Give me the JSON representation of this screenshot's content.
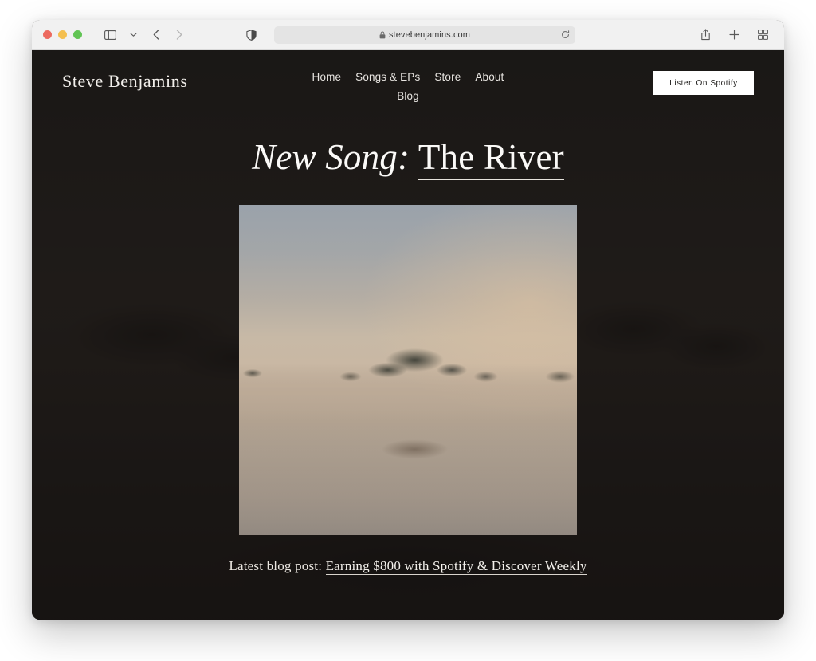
{
  "browser": {
    "traffic_lights": [
      "close",
      "minimize",
      "zoom"
    ],
    "sidebar_icon": "sidebar-icon",
    "chevron_icon": "chevron-down-icon",
    "back_icon": "back-arrow-icon",
    "forward_icon": "forward-arrow-icon",
    "shield_icon": "shield-privacy-icon",
    "lock_icon": "lock-icon",
    "reload_icon": "reload-icon",
    "share_icon": "share-icon",
    "new_tab_icon": "plus-icon",
    "tab_overview_icon": "tab-overview-icon",
    "url": "stevebenjamins.com"
  },
  "site": {
    "brand": "Steve Benjamins",
    "nav": [
      {
        "label": "Home",
        "active": true
      },
      {
        "label": "Songs & EPs",
        "active": false
      },
      {
        "label": "Store",
        "active": false
      },
      {
        "label": "About",
        "active": false
      },
      {
        "label": "Blog",
        "active": false
      }
    ],
    "cta": {
      "label": "Listen On Spotify"
    },
    "hero": {
      "headline_prefix": "New Song:",
      "headline_title": "The River",
      "cover_alt": "misty-river-landscape-cover-art"
    },
    "footer": {
      "blog_label": "Latest blog post:",
      "blog_link": "Earning $800 with Spotify & Discover Weekly"
    },
    "colors": {
      "page_background": "#2a2623",
      "text": "#f2efeb",
      "cta_background": "#ffffff",
      "cta_text": "#1d1b19"
    }
  }
}
